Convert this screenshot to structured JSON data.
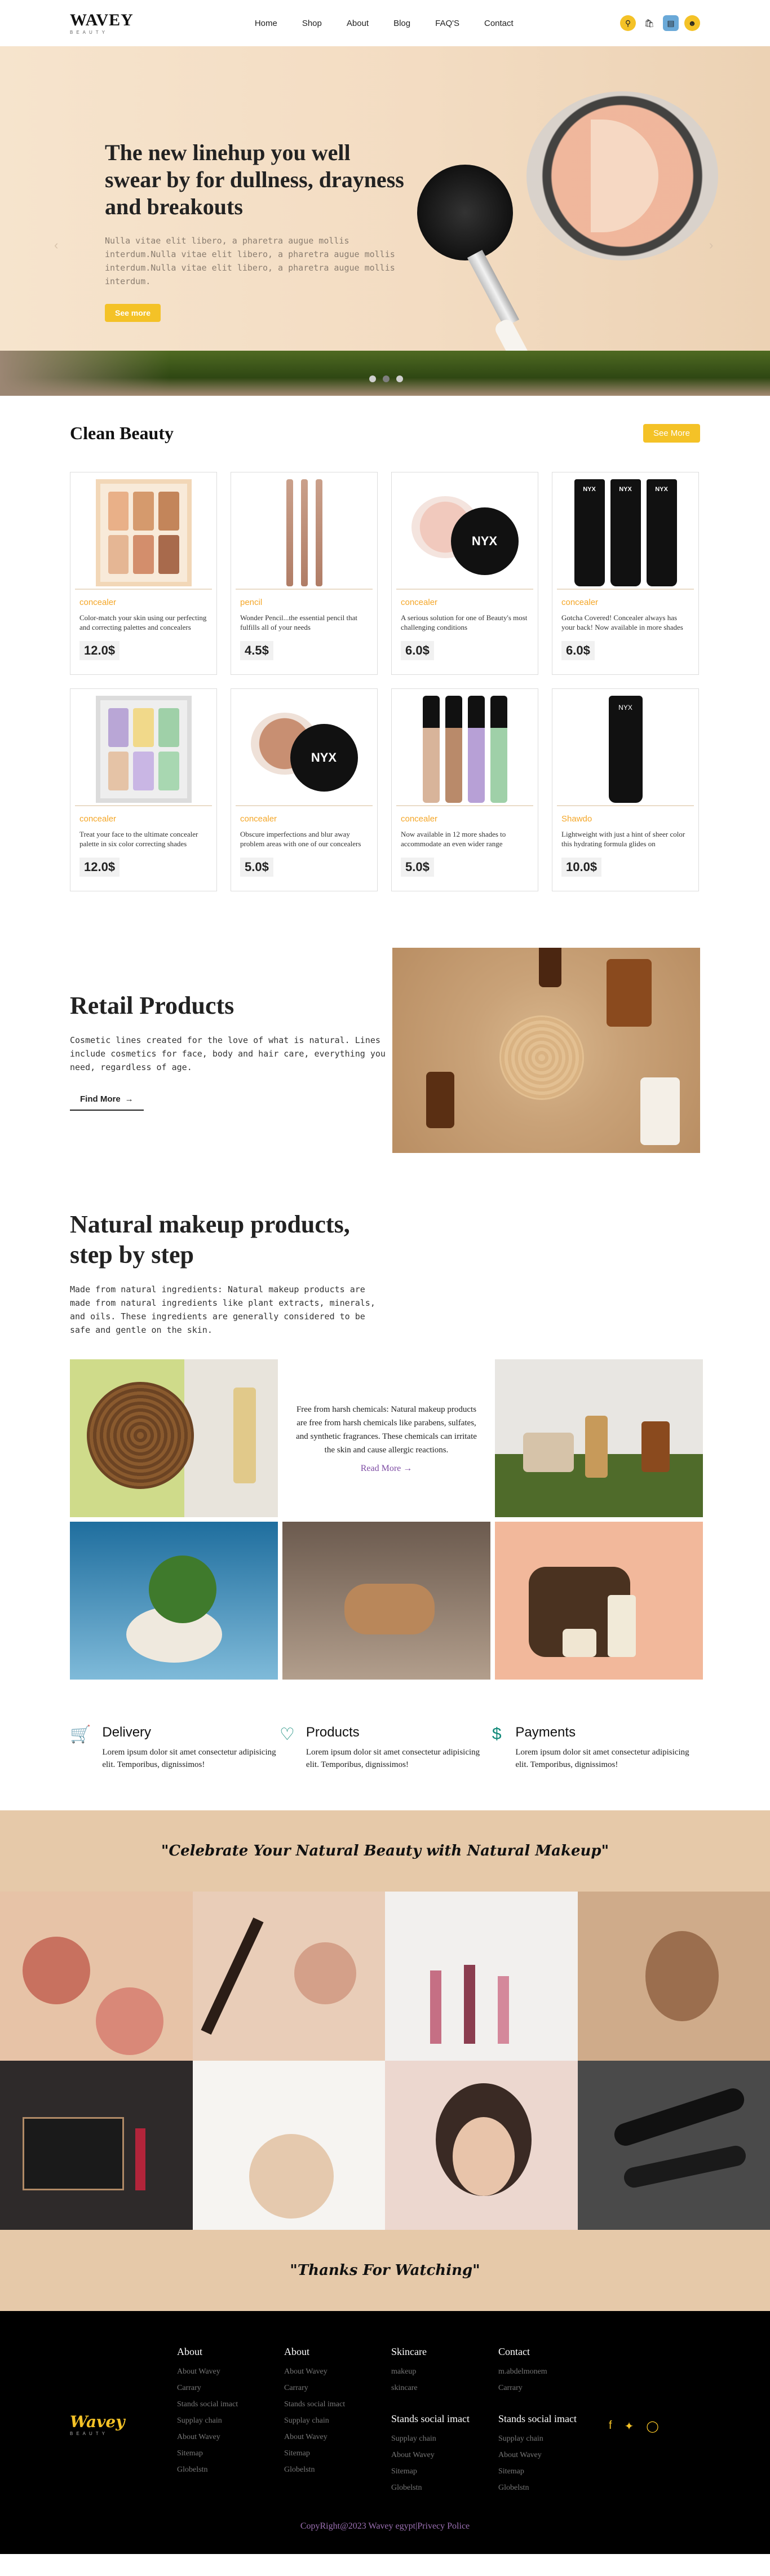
{
  "header": {
    "logo": "WAVEY",
    "logo_sub": "BEAUTY",
    "nav": [
      "Home",
      "Shop",
      "About",
      "Blog",
      "FAQ'S",
      "Contact"
    ],
    "icons": [
      "search-icon",
      "bag-icon",
      "card-icon",
      "user-icon"
    ]
  },
  "hero": {
    "title": "The new linehup you well swear by for dullness, drayness and breakouts",
    "desc": "Nulla vitae elit libero, a pharetra augue mollis interdum.Nulla vitae elit libero, a pharetra augue mollis interdum.Nulla vitae elit libero, a pharetra augue mollis interdum.",
    "button": "See more"
  },
  "clean_beauty": {
    "title": "Clean Beauty",
    "see_more": "See More",
    "products": [
      {
        "category": "concealer",
        "desc": "Color-match your skin using our perfecting and correcting palettes and concealers",
        "price": "12.0$"
      },
      {
        "category": "pencil",
        "desc": "Wonder Pencil...the essential pencil that fulfills all of your needs",
        "price": "4.5$"
      },
      {
        "category": "concealer",
        "desc": "A serious solution for one of Beauty's most challenging conditions",
        "price": "6.0$"
      },
      {
        "category": "concealer",
        "desc": "Gotcha Covered! Concealer always has your back! Now available in more shades",
        "price": "6.0$"
      },
      {
        "category": "concealer",
        "desc": "Treat your face to the ultimate concealer palette in six color correcting shades",
        "price": "12.0$"
      },
      {
        "category": "concealer",
        "desc": "Obscure imperfections and blur away problem areas with one of our concealers",
        "price": "5.0$"
      },
      {
        "category": "concealer",
        "desc": "Now available in 12 more shades to accommodate an even wider range",
        "price": "5.0$"
      },
      {
        "category": "Shawdo",
        "desc": "Lightweight with just a hint of sheer color this hydrating formula glides on",
        "price": "10.0$"
      }
    ]
  },
  "retail": {
    "title": "Retail Products",
    "desc": "Cosmetic lines created for the love of what is natural. Lines include cosmetics for face, body and hair care, everything you need, regardless of age.",
    "button": "Find More"
  },
  "natural": {
    "title": "Natural makeup products, step by step",
    "desc": "Made from natural ingredients: Natural makeup products are made from natural ingredients like plant extracts, minerals, and oils. These ingredients are generally considered to be safe and gentle on the skin.",
    "tile_text": "Free from harsh chemicals: Natural makeup products are free from harsh chemicals like parabens, sulfates, and synthetic fragrances. These chemicals can irritate the skin and cause allergic reactions.",
    "read_more": "Read More"
  },
  "features": [
    {
      "title": "Delivery",
      "desc": "Lorem ipsum dolor sit amet consectetur adipisicing elit. Temporibus, dignissimos!",
      "icon": "cart-icon"
    },
    {
      "title": "Products",
      "desc": "Lorem ipsum dolor sit amet consectetur adipisicing elit. Temporibus, dignissimos!",
      "icon": "chat-heart-icon"
    },
    {
      "title": "Payments",
      "desc": "Lorem ipsum dolor sit amet consectetur adipisicing elit. Temporibus, dignissimos!",
      "icon": "dollar-icon"
    }
  ],
  "banner_top": "\"Celebrate Your Natural Beauty with Natural Makeup\"",
  "banner_bottom": "\"Thanks For Watching\"",
  "footer": {
    "logo": "Wavey",
    "logo_sub": "BEAUTY",
    "columns": [
      {
        "head": "About",
        "items": [
          "About Wavey",
          "Carrary",
          "Stands social imact",
          "Supplay chain",
          "About Wavey",
          "Sitemap",
          "Globelstn"
        ]
      },
      {
        "head": "About",
        "items": [
          "About Wavey",
          "Carrary",
          "Stands social imact",
          "Supplay chain",
          "About Wavey",
          "Sitemap",
          "Globelstn"
        ]
      },
      {
        "head": "Skincare",
        "items": [
          "makeup",
          "skincare"
        ],
        "head2": "Stands social imact",
        "items2": [
          "Supplay chain",
          "About Wavey",
          "Sitemap",
          "Globelstn"
        ]
      },
      {
        "head": "Contact",
        "items": [
          "m.abdelmonem",
          "Carrary"
        ],
        "head2": "Stands social imact",
        "items2": [
          "Supplay chain",
          "About Wavey",
          "Sitemap",
          "Globelstn"
        ]
      }
    ],
    "social": [
      "facebook-icon",
      "twitter-icon",
      "instagram-icon"
    ],
    "copyright": "CopyRight@2023 Wavey egypt|Privecy Police"
  },
  "colors": {
    "accent": "#f4c227",
    "banner": "#e6c9a9",
    "teal": "#138a7a",
    "purple": "#7d4ba3"
  }
}
